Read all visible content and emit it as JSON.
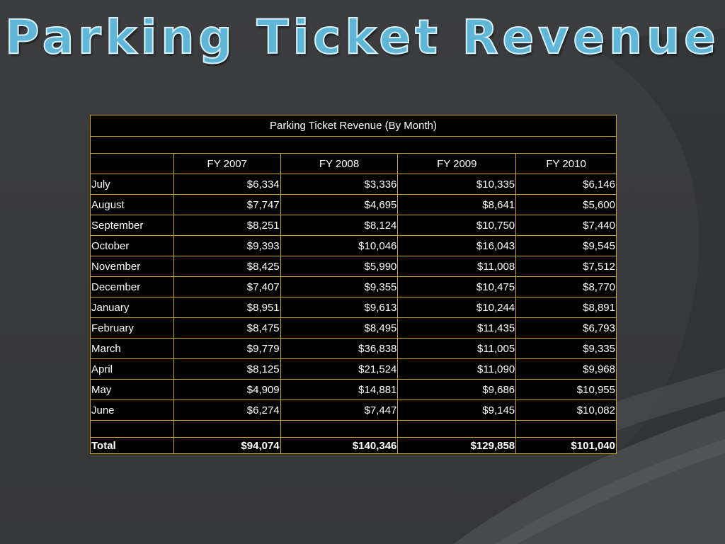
{
  "slide": {
    "title": "Parking Ticket Revenue",
    "colors": {
      "background": "#3a3b3d",
      "title": "#5fb6d6",
      "table_border": "#c9a227",
      "table_background": "#000000"
    }
  },
  "table": {
    "caption": "Parking Ticket Revenue (By Month)",
    "headers": [
      "",
      "FY 2007",
      "FY 2008",
      "FY 2009",
      "FY 2010"
    ],
    "rows": [
      [
        "July",
        "$6,334",
        "$3,336",
        "$10,335",
        "$6,146"
      ],
      [
        "August",
        "$7,747",
        "$4,695",
        "$8,641",
        "$5,600"
      ],
      [
        "September",
        "$8,251",
        "$8,124",
        "$10,750",
        "$7,440"
      ],
      [
        "October",
        "$9,393",
        "$10,046",
        "$16,043",
        "$9,545"
      ],
      [
        "November",
        "$8,425",
        "$5,990",
        "$11,008",
        "$7,512"
      ],
      [
        "December",
        "$7,407",
        "$9,355",
        "$10,475",
        "$8,770"
      ],
      [
        "January",
        "$8,951",
        "$9,613",
        "$10,244",
        "$8,891"
      ],
      [
        "February",
        "$8,475",
        "$8,495",
        "$11,435",
        "$6,793"
      ],
      [
        "March",
        "$9,779",
        "$36,838",
        "$11,005",
        "$9,335"
      ],
      [
        "April",
        "$8,125",
        "$21,524",
        "$11,090",
        "$9,968"
      ],
      [
        "May",
        "$4,909",
        "$14,881",
        "$9,686",
        "$10,955"
      ],
      [
        "June",
        "$6,274",
        "$7,447",
        "$9,145",
        "$10,082"
      ]
    ],
    "total": [
      "Total",
      "$94,074",
      "$140,346",
      "$129,858",
      "$101,040"
    ]
  }
}
